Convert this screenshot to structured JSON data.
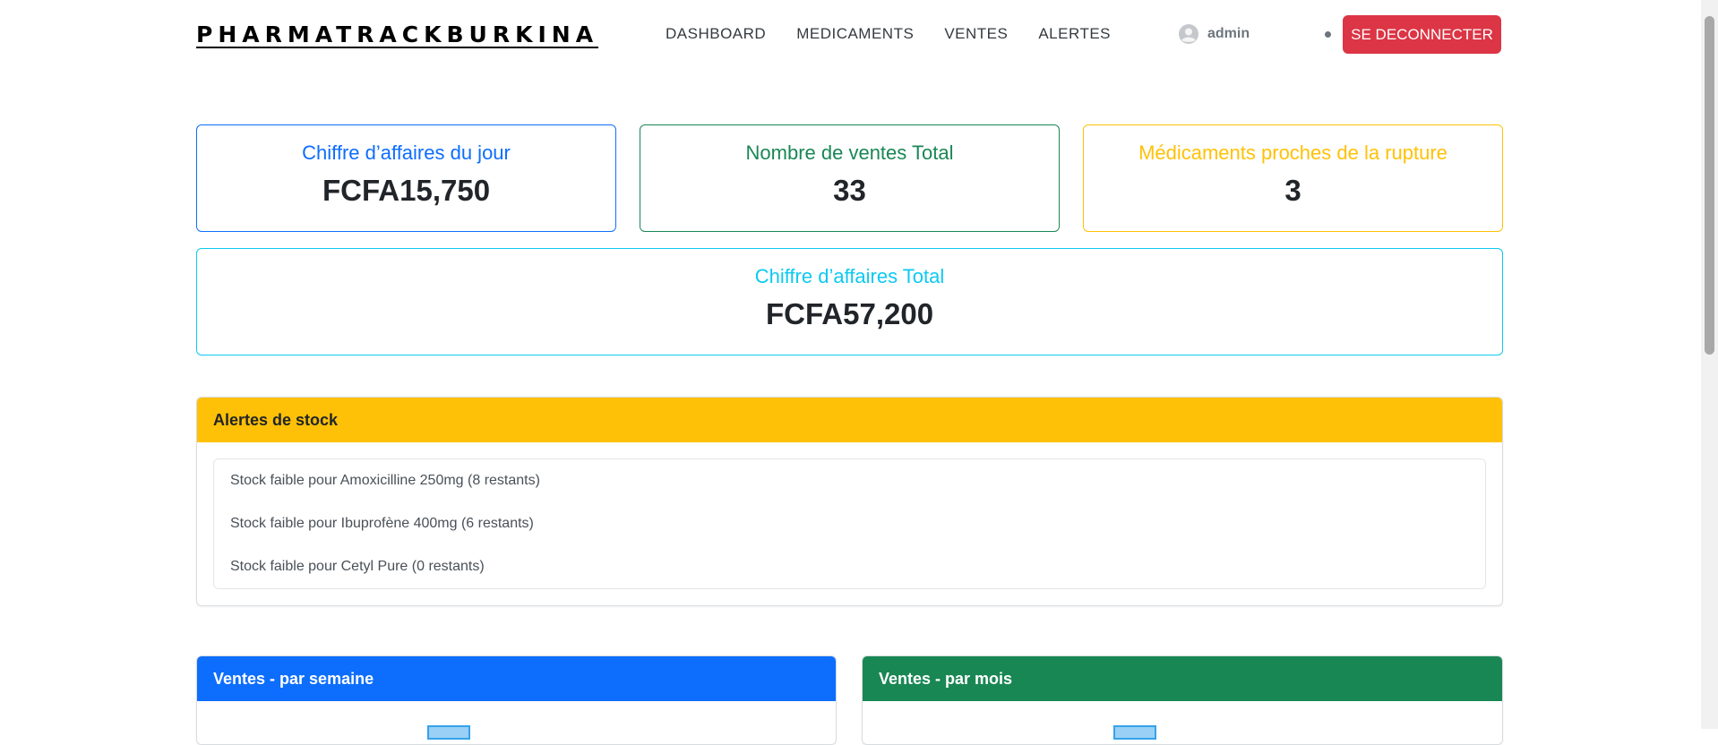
{
  "navbar": {
    "brand": "PHARMATRACKBURKINA",
    "links": [
      "DASHBOARD",
      "MEDICAMENTS",
      "VENTES",
      "ALERTES"
    ],
    "user": "admin",
    "logout_label": "SE DECONNECTER"
  },
  "stats": [
    {
      "label": "Chiffre d’affaires du jour",
      "value": "FCFA15,750",
      "color": "#0d6efd"
    },
    {
      "label": "Nombre de ventes Total",
      "value": "33",
      "color": "#198754"
    },
    {
      "label": "Médicaments proches de la rupture",
      "value": "3",
      "color": "#ffc107"
    },
    {
      "label": "Chiffre d’affaires Total",
      "value": "FCFA57,200",
      "color": "#0dcaf0"
    }
  ],
  "alerts": {
    "title": "Alertes de stock",
    "items": [
      "Stock faible pour Amoxicilline 250mg (8 restants)",
      "Stock faible pour Ibuprofène 400mg (6 restants)",
      "Stock faible pour Cetyl Pure (0 restants)"
    ]
  },
  "charts": {
    "weekly": {
      "title": "Ventes - par semaine",
      "color": "#0d6efd"
    },
    "monthly": {
      "title": "Ventes - par mois",
      "color": "#198754"
    }
  }
}
